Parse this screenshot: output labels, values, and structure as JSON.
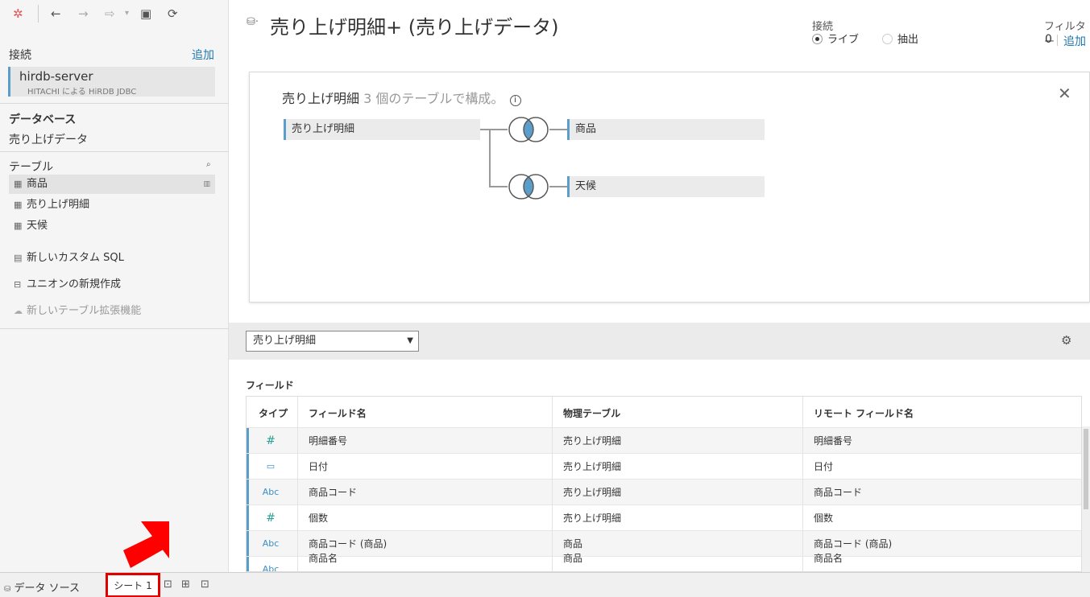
{
  "sidebar": {
    "connections_label": "接続",
    "add_label": "追加",
    "connection": {
      "name": "hirdb-server",
      "driver": "HITACHI による HiRDB JDBC"
    },
    "database_label": "データベース",
    "database_value": "売り上げデータ",
    "tables_label": "テーブル",
    "tables": [
      {
        "name": "商品"
      },
      {
        "name": "売り上げ明細"
      },
      {
        "name": "天候"
      }
    ],
    "actions": [
      {
        "label": "新しいカスタム SQL"
      },
      {
        "label": "ユニオンの新規作成"
      },
      {
        "label": "新しいテーブル拡張機能"
      }
    ]
  },
  "header": {
    "title": "売り上げ明細+ (売り上げデータ)",
    "connection_label": "接続",
    "live_label": "ライブ",
    "extract_label": "抽出",
    "filter_label": "フィルター",
    "filter_count": "0",
    "filter_add": "追加"
  },
  "canvas": {
    "title": "売り上げ明細",
    "subtitle": "3 個のテーブルで構成。",
    "info_glyph": "i",
    "close_glyph": "✕",
    "root_table": "売り上げ明細",
    "joined_tables": [
      "商品",
      "天候"
    ]
  },
  "metadata": {
    "selected_table": "売り上げ明細",
    "fields_label": "フィールド",
    "columns": [
      "タイプ",
      "フィールド名",
      "物理テーブル",
      "リモート フィールド名"
    ],
    "rows": [
      {
        "type": "#",
        "name": "明細番号",
        "table": "売り上げ明細",
        "remote": "明細番号"
      },
      {
        "type": "▭",
        "name": "日付",
        "table": "売り上げ明細",
        "remote": "日付"
      },
      {
        "type": "Abc",
        "name": "商品コード",
        "table": "売り上げ明細",
        "remote": "商品コード"
      },
      {
        "type": "#",
        "name": "個数",
        "table": "売り上げ明細",
        "remote": "個数"
      },
      {
        "type": "Abc",
        "name": "商品コード (商品)",
        "table": "商品",
        "remote": "商品コード (商品)"
      },
      {
        "type": "Abc",
        "name": "商品名",
        "table": "商品",
        "remote": "商品名"
      }
    ]
  },
  "tabs": {
    "datasource_label": "データ ソース",
    "sheet_label": "シート 1"
  },
  "colors": {
    "accent": "#5b9ec9",
    "link": "#1f77b4",
    "highlight": "#e00000"
  }
}
